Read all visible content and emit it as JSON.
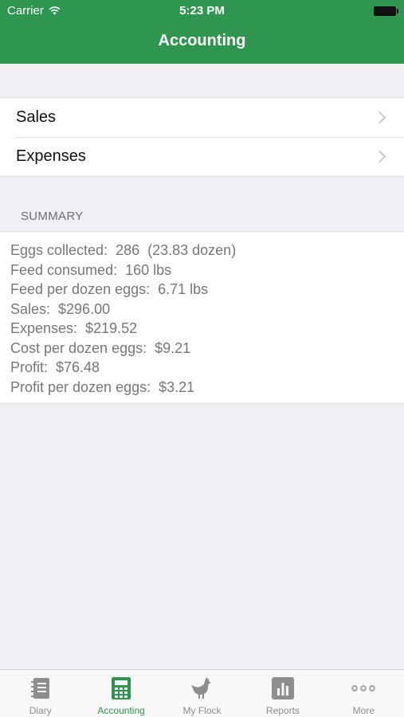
{
  "status_bar": {
    "carrier": "Carrier",
    "time": "5:23 PM"
  },
  "nav": {
    "title": "Accounting"
  },
  "menu": [
    {
      "label": "Sales"
    },
    {
      "label": "Expenses"
    }
  ],
  "summary": {
    "header": "SUMMARY",
    "lines": [
      "Eggs collected:  286  (23.83 dozen)",
      "Feed consumed:  160 lbs",
      "Feed per dozen eggs:  6.71 lbs",
      "Sales:  $296.00",
      "Expenses:  $219.52",
      "Cost per dozen eggs:  $9.21",
      "Profit:  $76.48",
      "Profit per dozen eggs:  $3.21"
    ]
  },
  "tabbar": {
    "tabs": [
      {
        "label": "Diary",
        "icon": "diary-icon"
      },
      {
        "label": "Accounting",
        "icon": "calculator-icon"
      },
      {
        "label": "My Flock",
        "icon": "chicken-icon"
      },
      {
        "label": "Reports",
        "icon": "bar-chart-icon"
      },
      {
        "label": "More",
        "icon": "more-icon"
      }
    ],
    "active": "Accounting"
  },
  "colors": {
    "brand_green": "#2f9650",
    "background": "#efeff4",
    "inactive_tab": "#8e8e8e"
  }
}
